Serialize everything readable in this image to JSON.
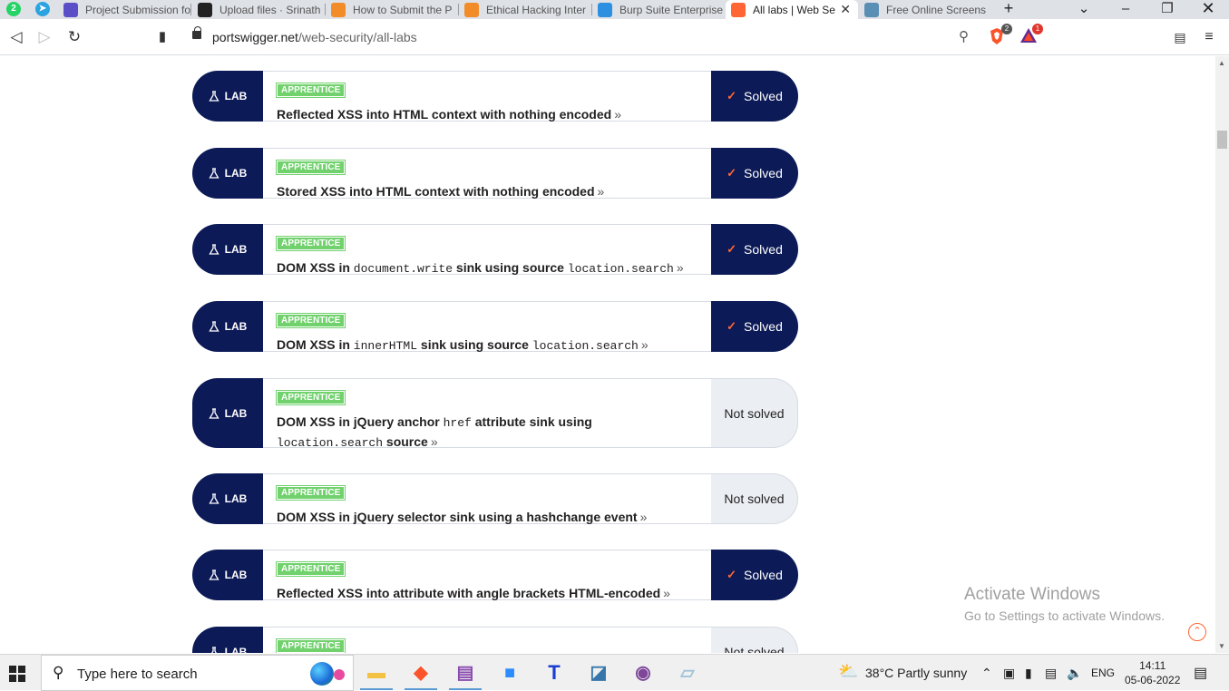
{
  "browser": {
    "tabs": [
      {
        "title": "Project Submission fo",
        "favicon": "purple-form-icon",
        "color": "#5b4fc7"
      },
      {
        "title": "Upload files · Srinath",
        "favicon": "github-icon",
        "color": "#222222"
      },
      {
        "title": "How to Submit the P",
        "favicon": "orange-pin-icon",
        "color": "#f28c28"
      },
      {
        "title": "Ethical Hacking Inter",
        "favicon": "orange-pin-icon",
        "color": "#f28c28"
      },
      {
        "title": "Burp Suite Enterprise",
        "favicon": "burp-icon",
        "color": "#2d8fe0"
      },
      {
        "title": "All labs | Web Se",
        "favicon": "portswigger-icon",
        "color": "#ff6633",
        "active": true
      },
      {
        "title": "Free Online Screensh",
        "favicon": "screenshot-icon",
        "color": "#5a8fb5"
      }
    ],
    "pinned": [
      {
        "name": "whatsapp-icon",
        "label": "2",
        "color": "#25d366"
      },
      {
        "name": "telegram-icon",
        "label": "➤",
        "color": "#2aa3e0"
      }
    ],
    "new_tab": "+",
    "url_host": "portswigger.net",
    "url_path": "/web-security/all-labs",
    "brave_badge": "2",
    "rewards_badge": "1"
  },
  "labs": [
    {
      "tag": "LAB",
      "level": "APPRENTICE",
      "title": [
        {
          "t": "Reflected XSS into HTML context with nothing encoded"
        }
      ],
      "status": "Solved",
      "solved": true
    },
    {
      "tag": "LAB",
      "level": "APPRENTICE",
      "title": [
        {
          "t": "Stored XSS into HTML context with nothing encoded"
        }
      ],
      "status": "Solved",
      "solved": true
    },
    {
      "tag": "LAB",
      "level": "APPRENTICE",
      "title": [
        {
          "t": "DOM XSS in "
        },
        {
          "c": "document.write"
        },
        {
          "t": " sink using source "
        },
        {
          "c": "location.search"
        }
      ],
      "status": "Solved",
      "solved": true
    },
    {
      "tag": "LAB",
      "level": "APPRENTICE",
      "title": [
        {
          "t": "DOM XSS in "
        },
        {
          "c": "innerHTML"
        },
        {
          "t": " sink using source "
        },
        {
          "c": "location.search"
        }
      ],
      "status": "Solved",
      "solved": true
    },
    {
      "tag": "LAB",
      "level": "APPRENTICE",
      "title": [
        {
          "t": "DOM XSS in jQuery anchor "
        },
        {
          "c": "href"
        },
        {
          "t": " attribute sink using "
        },
        {
          "c": "location.search"
        },
        {
          "t": " source"
        }
      ],
      "status": "Not solved",
      "solved": false
    },
    {
      "tag": "LAB",
      "level": "APPRENTICE",
      "title": [
        {
          "t": "DOM XSS in jQuery selector sink using a hashchange event"
        }
      ],
      "status": "Not solved",
      "solved": false
    },
    {
      "tag": "LAB",
      "level": "APPRENTICE",
      "title": [
        {
          "t": "Reflected XSS into attribute with angle brackets HTML-encoded"
        }
      ],
      "status": "Solved",
      "solved": true
    },
    {
      "tag": "LAB",
      "level": "APPRENTICE",
      "title": [
        {
          "t": ""
        }
      ],
      "status": "Not solved",
      "solved": false
    }
  ],
  "watermark": {
    "line1": "Activate Windows",
    "line2": "Go to Settings to activate Windows."
  },
  "taskbar": {
    "search_placeholder": "Type here to search",
    "weather": "38°C  Partly sunny",
    "language": "ENG",
    "time": "14:11",
    "date": "05-06-2022",
    "apps": [
      {
        "name": "file-explorer-icon",
        "color": "#f4c242",
        "glyph": "▬"
      },
      {
        "name": "brave-icon",
        "color": "#fb542b",
        "glyph": "◆"
      },
      {
        "name": "winrar-icon",
        "color": "#8a4caf",
        "glyph": "▤"
      },
      {
        "name": "zoom-icon",
        "color": "#2d8cff",
        "glyph": "■"
      },
      {
        "name": "typora-icon",
        "color": "#ffffff",
        "glyph": "T"
      },
      {
        "name": "python-icon",
        "color": "#3776ab",
        "glyph": "◪"
      },
      {
        "name": "tor-icon",
        "color": "#7d4698",
        "glyph": "◉"
      },
      {
        "name": "notepad-icon",
        "color": "#9fc6d8",
        "glyph": "▱"
      }
    ]
  }
}
